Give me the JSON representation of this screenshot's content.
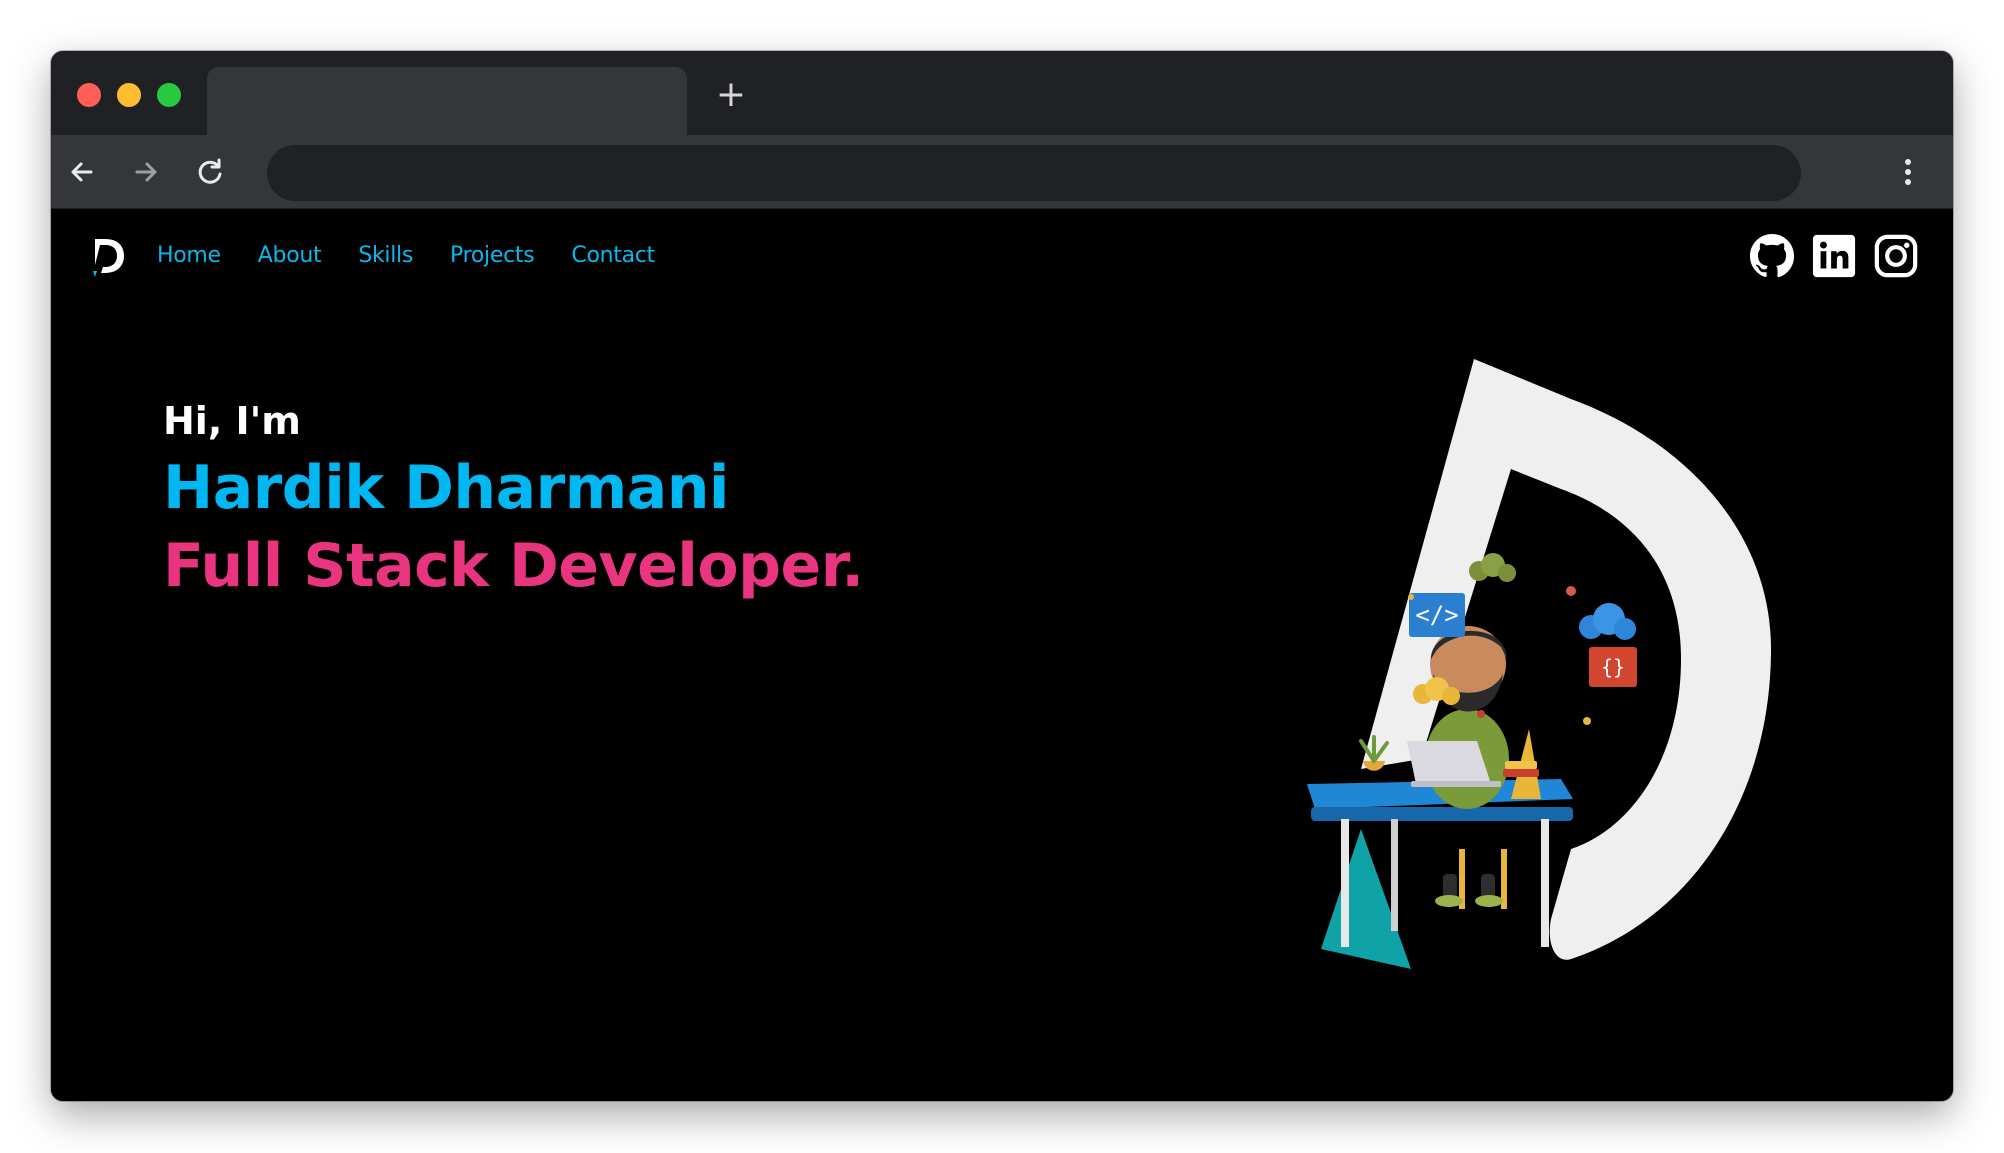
{
  "browser": {
    "tab_title": "",
    "new_tab_label": "+",
    "address": "",
    "colors": {
      "titlebar": "#202124",
      "toolbar": "#35363a",
      "omnibox": "#202124"
    }
  },
  "nav": {
    "logo": "D",
    "links": [
      {
        "label": "Home"
      },
      {
        "label": "About"
      },
      {
        "label": "Skills"
      },
      {
        "label": "Projects"
      },
      {
        "label": "Contact"
      }
    ],
    "social": [
      {
        "icon": "github-icon"
      },
      {
        "icon": "linkedin-icon"
      },
      {
        "icon": "instagram-icon"
      }
    ],
    "link_color": "#0bb6ea"
  },
  "hero": {
    "greeting": "Hi, I'm",
    "name": "Hardik Dharmani",
    "role": "Full Stack Developer.",
    "colors": {
      "greeting": "#ffffff",
      "name": "#00b7f1",
      "role": "#e9357f"
    }
  },
  "illustration": {
    "description_icon": "developer-at-desk-illustration",
    "code_badge": "</>",
    "brace_badge": "{}"
  }
}
